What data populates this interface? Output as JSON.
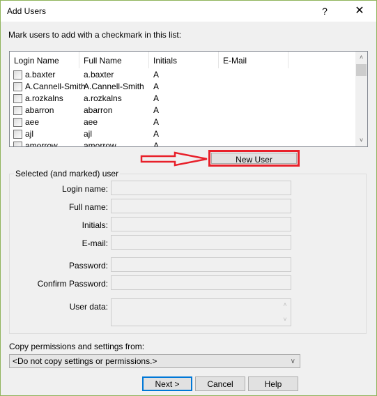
{
  "window": {
    "title": "Add Users",
    "help_label": "?",
    "close_label": "✕"
  },
  "instruction": "Mark users to add with a checkmark in this list:",
  "list": {
    "columns": [
      "Login Name",
      "Full Name",
      "Initials",
      "E-Mail"
    ],
    "rows": [
      {
        "login": "a.baxter",
        "full": "a.baxter",
        "initials": "A",
        "email": ""
      },
      {
        "login": "A.Cannell-Smith",
        "full": "A.Cannell-Smith",
        "initials": "A",
        "email": ""
      },
      {
        "login": "a.rozkalns",
        "full": "a.rozkalns",
        "initials": "A",
        "email": ""
      },
      {
        "login": "abarron",
        "full": "abarron",
        "initials": "A",
        "email": ""
      },
      {
        "login": "aee",
        "full": "aee",
        "initials": "A",
        "email": ""
      },
      {
        "login": "ajl",
        "full": "ajl",
        "initials": "A",
        "email": ""
      },
      {
        "login": "amorrow",
        "full": "amorrow",
        "initials": "A",
        "email": ""
      }
    ],
    "scroll_up": "˄",
    "scroll_down": "˅"
  },
  "new_user_button": "New User",
  "selected_group": {
    "legend": "Selected (and marked) user",
    "login_label": "Login name:",
    "fullname_label": "Full name:",
    "initials_label": "Initials:",
    "email_label": "E-mail:",
    "password_label": "Password:",
    "confirm_label": "Confirm Password:",
    "userdata_label": "User data:",
    "login_value": "",
    "fullname_value": "",
    "initials_value": "",
    "email_value": "",
    "password_value": "",
    "confirm_value": "",
    "userdata_value": ""
  },
  "copy": {
    "label": "Copy permissions and settings from:",
    "selected": "<Do not copy settings or permissions.>",
    "arrow": "∨"
  },
  "buttons": {
    "next": "Next >",
    "cancel": "Cancel",
    "help": "Help"
  },
  "colors": {
    "annotation_red": "#e8202a",
    "default_button_border": "#0078d7",
    "window_border": "#8fb35a"
  }
}
